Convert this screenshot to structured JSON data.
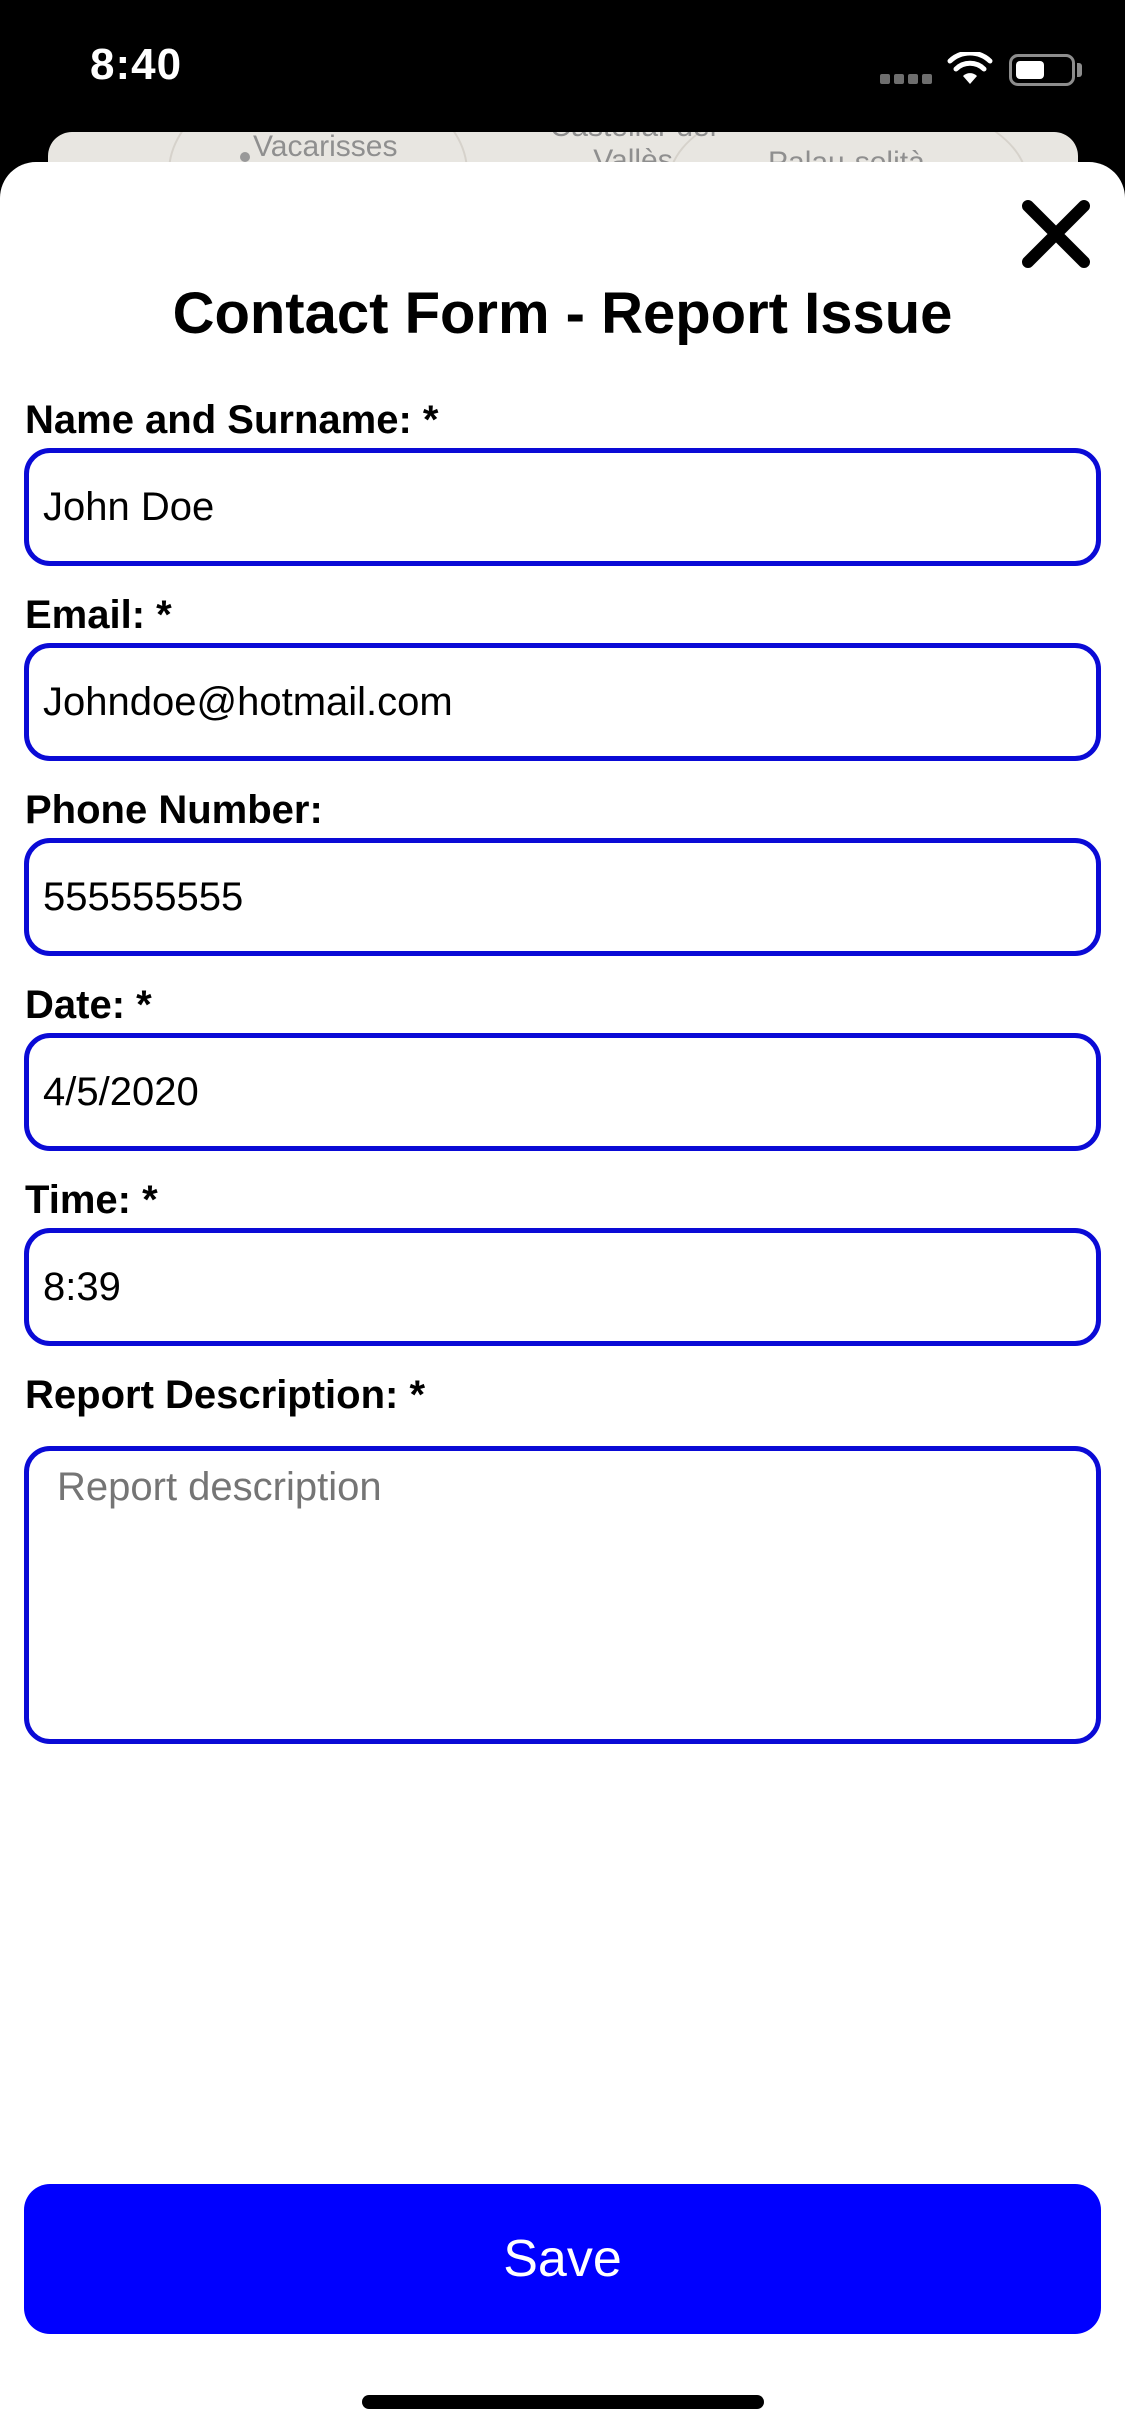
{
  "status_bar": {
    "time": "8:40",
    "icons": [
      "cellular-signal-icon",
      "wifi-icon",
      "battery-icon"
    ]
  },
  "map": {
    "labels": [
      "Vacarisses",
      "Castellar del Vallès",
      "Palau-solità"
    ]
  },
  "form": {
    "title": "Contact Form - Report Issue",
    "close_icon": "close-icon",
    "fields": [
      {
        "label": "Name and Surname: *",
        "value": "John Doe"
      },
      {
        "label": "Email: *",
        "value": "Johndoe@hotmail.com"
      },
      {
        "label": "Phone Number:",
        "value": "555555555"
      },
      {
        "label": "Date: *",
        "value": "4/5/2020"
      },
      {
        "label": "Time: *",
        "value": "8:39"
      }
    ],
    "description": {
      "label": "Report Description: *",
      "placeholder": "Report description"
    },
    "save_label": "Save"
  },
  "colors": {
    "accent": "#0000ff",
    "field_border": "#0a0ad6"
  }
}
